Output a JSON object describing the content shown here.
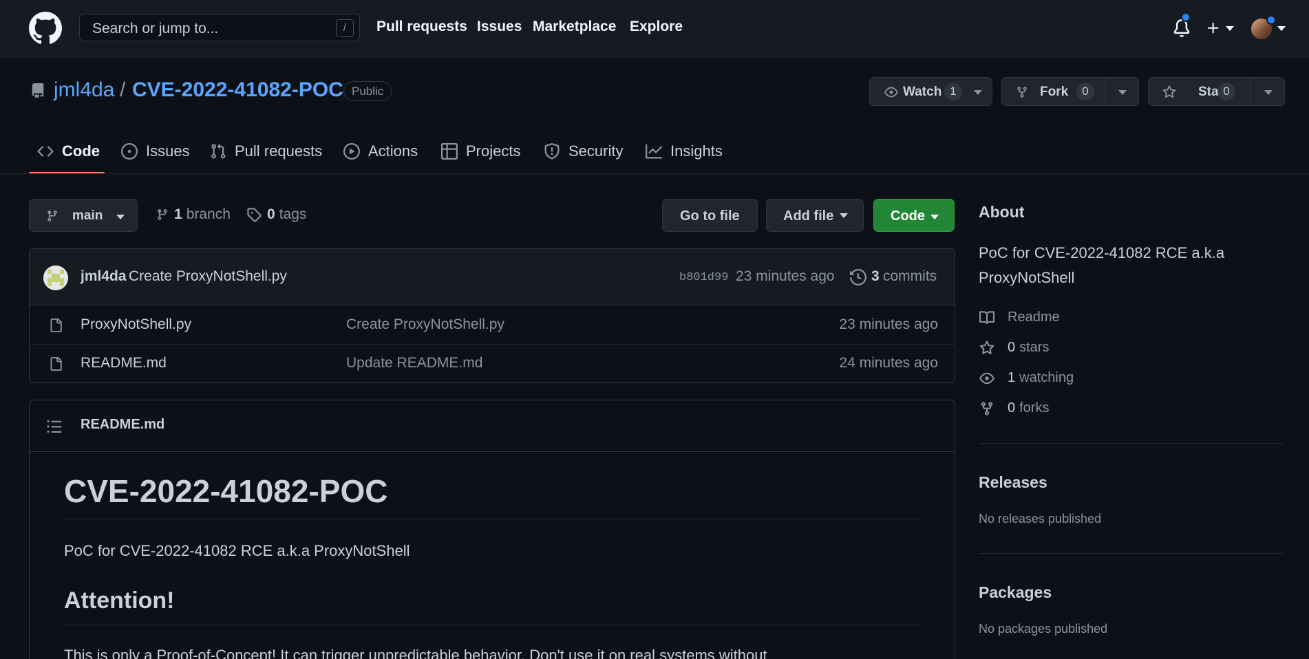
{
  "header": {
    "search_placeholder": "Search or jump to...",
    "search_shortcut": "/",
    "nav": [
      "Pull requests",
      "Issues",
      "Marketplace",
      "Explore"
    ]
  },
  "repo": {
    "owner": "jml4da",
    "separator": "/",
    "name": "CVE-2022-41082-POC",
    "visibility": "Public",
    "watch": {
      "label": "Watch",
      "count": "1"
    },
    "fork": {
      "label": "Fork",
      "count": "0"
    },
    "star": {
      "label": "Star",
      "count": "0"
    }
  },
  "tabs": [
    "Code",
    "Issues",
    "Pull requests",
    "Actions",
    "Projects",
    "Security",
    "Insights"
  ],
  "file_nav": {
    "branch": "main",
    "branches_count": "1",
    "branches_label": "branch",
    "tags_count": "0",
    "tags_label": "tags",
    "go_to_file": "Go to file",
    "add_file": "Add file",
    "code": "Code"
  },
  "latest_commit": {
    "author": "jml4da",
    "message": "Create ProxyNotShell.py",
    "sha": "b801d99",
    "age": "23 minutes ago",
    "commits_count": "3",
    "commits_label": "commits"
  },
  "files": [
    {
      "name": "ProxyNotShell.py",
      "message": "Create ProxyNotShell.py",
      "age": "23 minutes ago"
    },
    {
      "name": "README.md",
      "message": "Update README.md",
      "age": "24 minutes ago"
    }
  ],
  "readme": {
    "filename": "README.md",
    "title": "CVE-2022-41082-POC",
    "intro": "PoC for CVE-2022-41082 RCE a.k.a ProxyNotShell",
    "attention_heading": "Attention!",
    "attention_text": "This is only a Proof-of-Concept! It can trigger unpredictable behavior. Don't use it on real systems without"
  },
  "about": {
    "heading": "About",
    "description": "PoC for CVE-2022-41082 RCE a.k.a ProxyNotShell",
    "readme": "Readme",
    "stars_count": "0",
    "stars_label": "stars",
    "watching_count": "1",
    "watching_label": "watching",
    "forks_count": "0",
    "forks_label": "forks"
  },
  "releases": {
    "heading": "Releases",
    "empty": "No releases published"
  },
  "packages": {
    "heading": "Packages",
    "empty": "No packages published"
  },
  "colors": {
    "background": "#0d1117",
    "header": "#161b22",
    "link": "#58a6ff",
    "primary_button": "#238636",
    "tab_underline": "#f78166",
    "notification_dot": "#2f81f7"
  }
}
